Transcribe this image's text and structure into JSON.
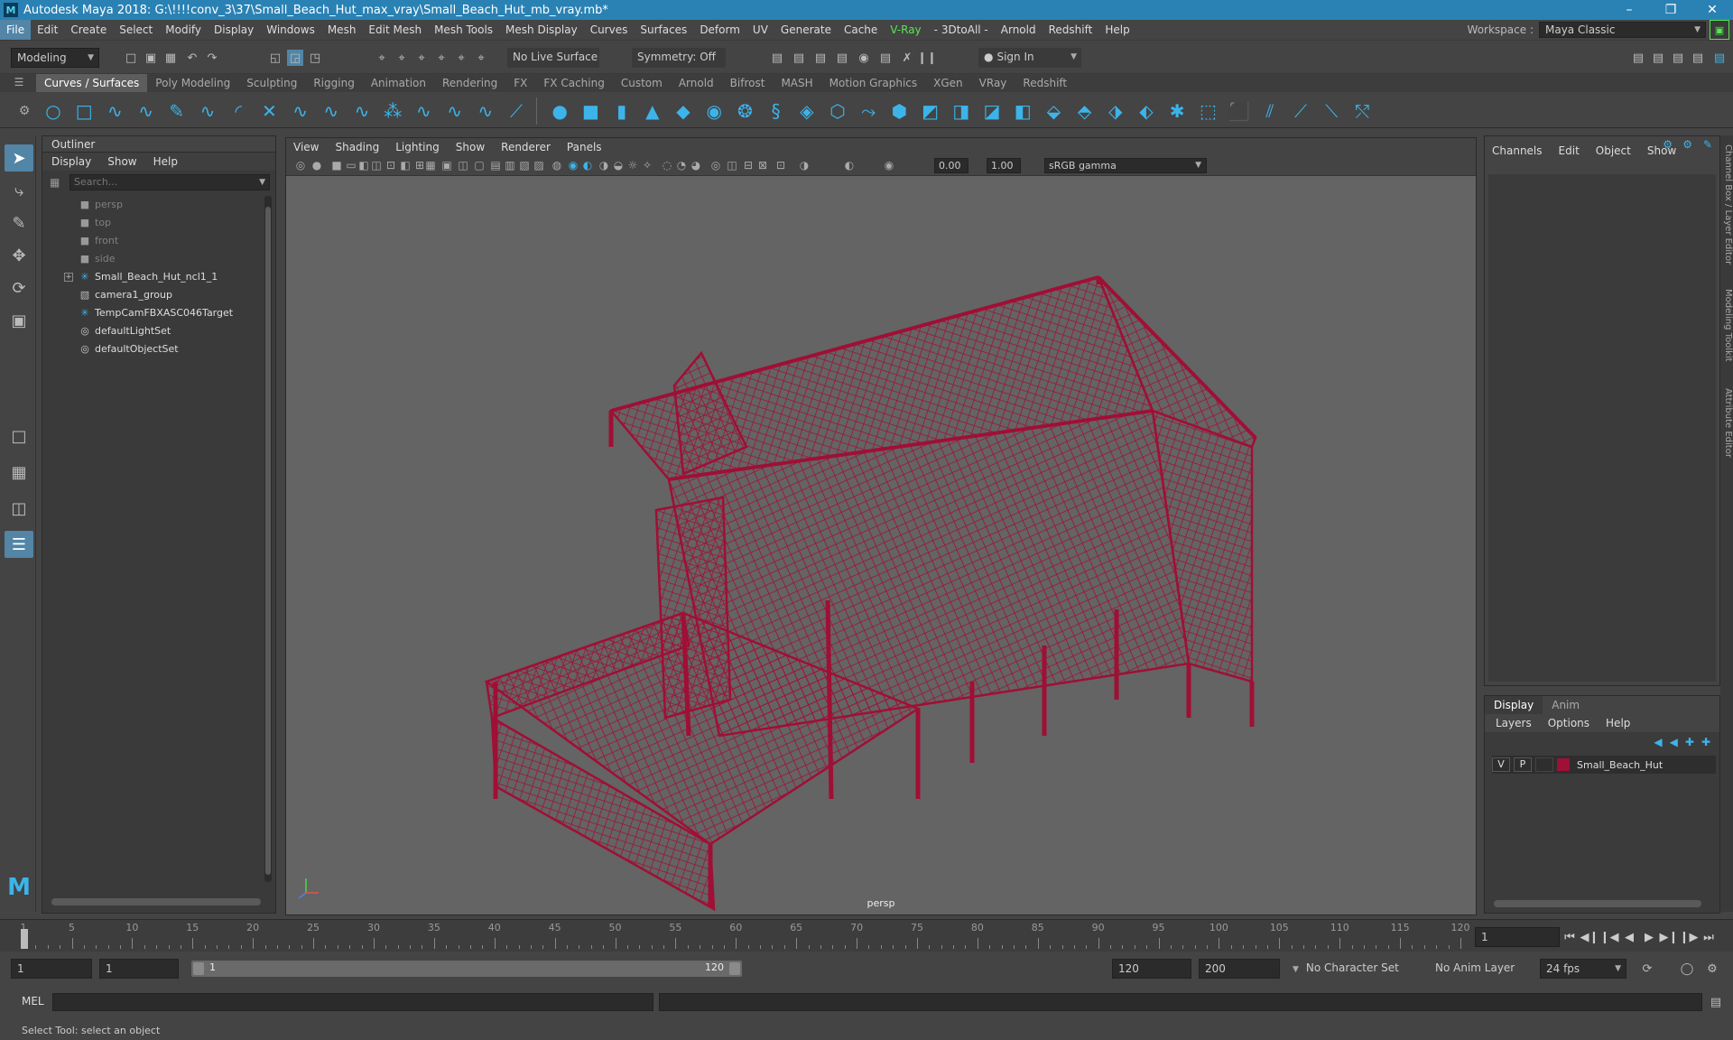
{
  "title": "Autodesk Maya 2018: G:\\!!!!conv_3\\37\\Small_Beach_Hut_max_vray\\Small_Beach_Hut_mb_vray.mb*",
  "menus": [
    "File",
    "Edit",
    "Create",
    "Select",
    "Modify",
    "Display",
    "Windows",
    "Mesh",
    "Edit Mesh",
    "Mesh Tools",
    "Mesh Display",
    "Curves",
    "Surfaces",
    "Deform",
    "UV",
    "Generate",
    "Cache",
    "V-Ray",
    "- 3DtoAll -",
    "Arnold",
    "Redshift",
    "Help"
  ],
  "workspace": {
    "label": "Workspace :",
    "value": "Maya Classic"
  },
  "status": {
    "mode": "Modeling",
    "live_surface": "No Live Surface",
    "symmetry": "Symmetry: Off",
    "sign_in": "Sign In"
  },
  "shelf_tabs": [
    "Curves / Surfaces",
    "Poly Modeling",
    "Sculpting",
    "Rigging",
    "Animation",
    "Rendering",
    "FX",
    "FX Caching",
    "Custom",
    "Arnold",
    "Bifrost",
    "MASH",
    "Motion Graphics",
    "XGen",
    "VRay",
    "Redshift"
  ],
  "outliner": {
    "title": "Outliner",
    "menu": [
      "Display",
      "Show",
      "Help"
    ],
    "search_placeholder": "Search...",
    "items": [
      {
        "label": "persp",
        "icon": "camera-icon",
        "dim": true
      },
      {
        "label": "top",
        "icon": "camera-icon",
        "dim": true
      },
      {
        "label": "front",
        "icon": "camera-icon",
        "dim": true
      },
      {
        "label": "side",
        "icon": "camera-icon",
        "dim": true
      },
      {
        "label": "Small_Beach_Hut_ncl1_1",
        "icon": "locator-icon",
        "dim": false,
        "expand": true
      },
      {
        "label": "camera1_group",
        "icon": "group-icon",
        "dim": false
      },
      {
        "label": "TempCamFBXASC046Target",
        "icon": "locator-icon",
        "dim": false
      },
      {
        "label": "defaultLightSet",
        "icon": "set-icon",
        "dim": false
      },
      {
        "label": "defaultObjectSet",
        "icon": "set-icon",
        "dim": false
      }
    ]
  },
  "viewport": {
    "menu": [
      "View",
      "Shading",
      "Lighting",
      "Show",
      "Renderer",
      "Panels"
    ],
    "exposure": "0.00",
    "gamma": "1.00",
    "colorspace": "sRGB gamma",
    "camera": "persp",
    "wire_color": "#a00f35"
  },
  "channelbox": {
    "menu": [
      "Channels",
      "Edit",
      "Object",
      "Show"
    ]
  },
  "layers": {
    "tabs": [
      "Display",
      "Anim"
    ],
    "menu": [
      "Layers",
      "Options",
      "Help"
    ],
    "row": {
      "v": "V",
      "p": "P",
      "name": "Small_Beach_Hut",
      "color": "#a00f35"
    }
  },
  "side_tabs": [
    "Channel Box / Layer Editor",
    "Modeling Toolkit",
    "Attribute Editor"
  ],
  "timeline": {
    "ticks": [
      "5",
      "10",
      "15",
      "20",
      "25",
      "30",
      "35",
      "40",
      "45",
      "50",
      "55",
      "60",
      "65",
      "70",
      "75",
      "80",
      "85",
      "90",
      "95",
      "100",
      "105",
      "110",
      "115",
      "120"
    ],
    "start_tick": "1",
    "current_frame": "1"
  },
  "range": {
    "start": "1",
    "start2": "1",
    "slider_start": "1",
    "slider_end": "120",
    "end": "120",
    "end2": "200",
    "character_set": "No Character Set",
    "anim_layer": "No Anim Layer",
    "fps": "24 fps"
  },
  "cmd": {
    "label": "MEL"
  },
  "help_line": "Select Tool: select an object"
}
